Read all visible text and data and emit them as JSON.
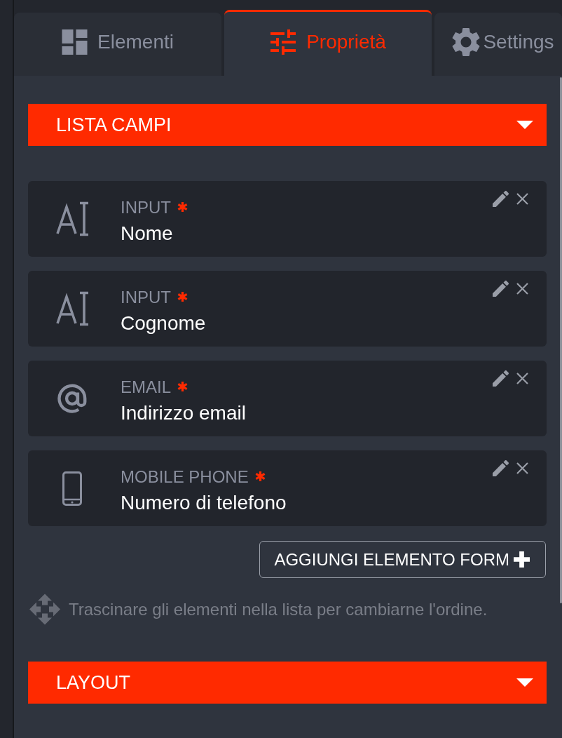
{
  "tabs": [
    {
      "label": "Elementi",
      "kind": "grid",
      "selected": false
    },
    {
      "label": "Proprietà",
      "kind": "sliders",
      "selected": true
    },
    {
      "label": "Settings",
      "kind": "gear",
      "selected": false
    }
  ],
  "field_list": {
    "title": "LISTA CAMPI",
    "fields": [
      {
        "kind": "text",
        "type": "INPUT",
        "required": true,
        "name": "Nome"
      },
      {
        "kind": "text",
        "type": "INPUT",
        "required": true,
        "name": "Cognome"
      },
      {
        "kind": "email",
        "type": "EMAIL",
        "required": true,
        "name": "Indirizzo email"
      },
      {
        "kind": "phone",
        "type": "MOBILE PHONE",
        "required": true,
        "name": "Numero di telefono"
      }
    ],
    "add_button": "AGGIUNGI ELEMENTO FORM",
    "hint": "Trascinare gli elementi nella lista per cambiarne l'ordine."
  },
  "layout_section": {
    "title": "LAYOUT"
  }
}
